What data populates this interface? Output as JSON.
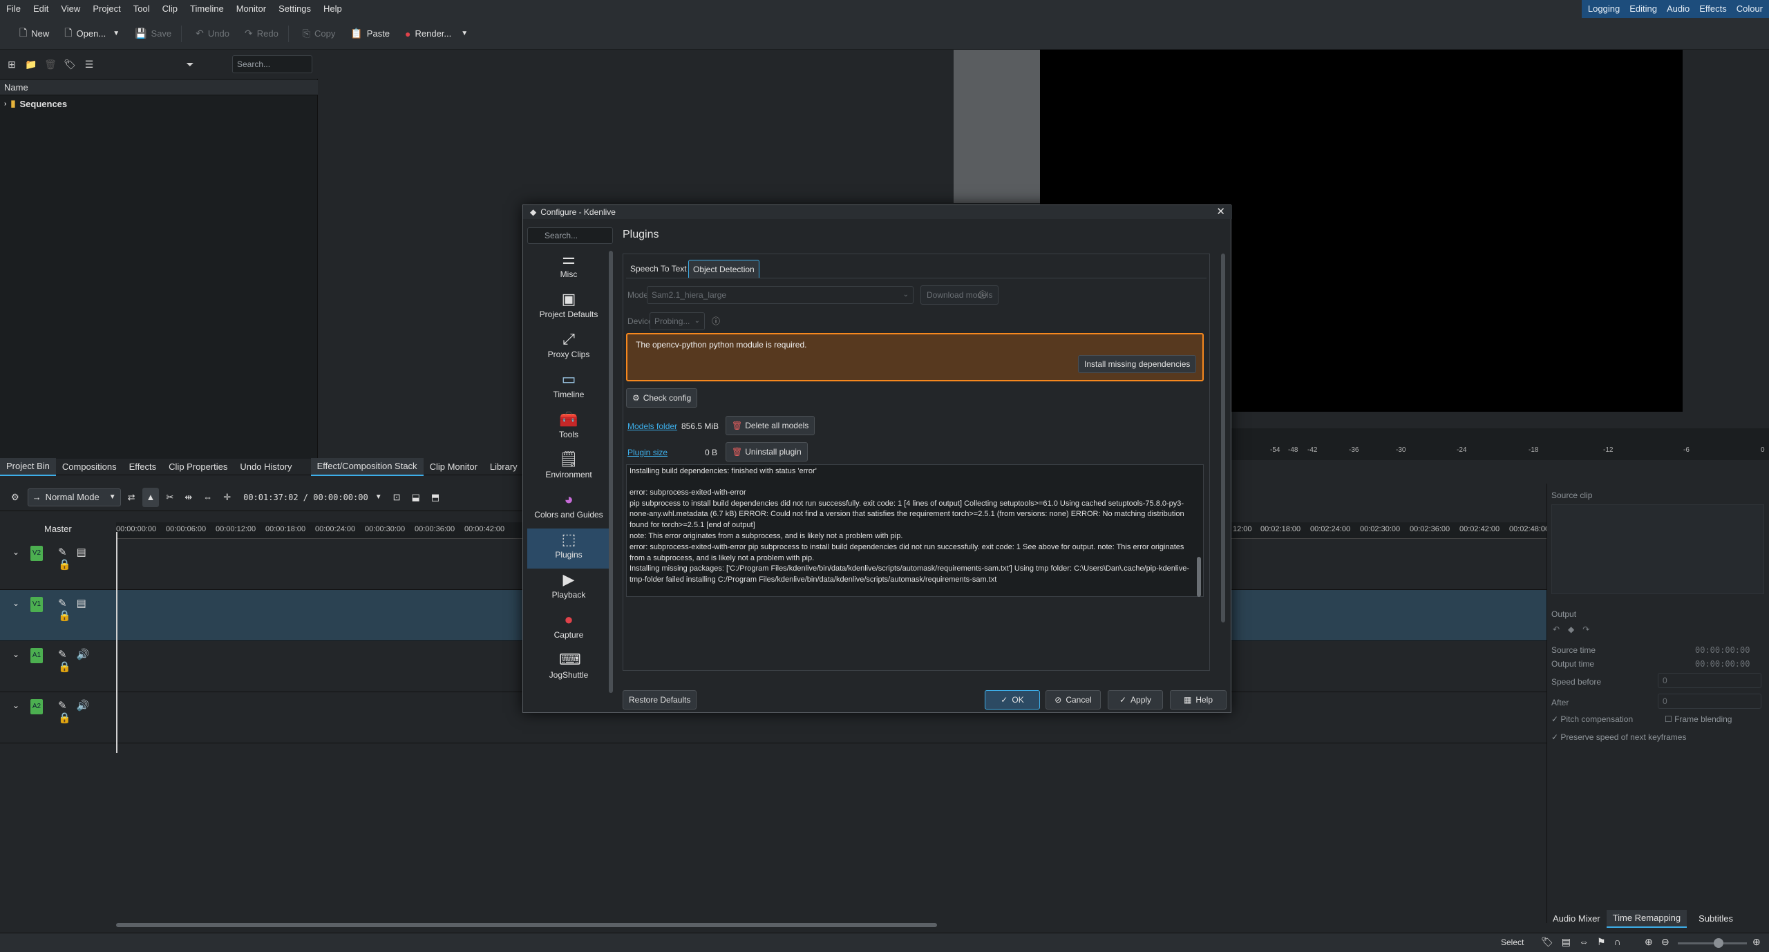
{
  "menubar": {
    "items": [
      "File",
      "Edit",
      "View",
      "Project",
      "Tool",
      "Clip",
      "Timeline",
      "Monitor",
      "Settings",
      "Help"
    ],
    "layouts": [
      "Logging",
      "Editing",
      "Audio",
      "Effects",
      "Colour"
    ]
  },
  "toolbar": {
    "new": "New",
    "open": "Open...",
    "save": "Save",
    "undo": "Undo",
    "redo": "Redo",
    "copy": "Copy",
    "paste": "Paste",
    "render": "Render..."
  },
  "bin": {
    "search_placeholder": "Search...",
    "column_name": "Name",
    "items": [
      "Sequences"
    ]
  },
  "bottom_tabs": [
    "Project Bin",
    "Compositions",
    "Effects",
    "Clip Properties",
    "Undo History",
    "Effect/Composition Stack",
    "Clip Monitor",
    "Library"
  ],
  "timeline": {
    "mode": "Normal Mode",
    "timecode": "00:01:37:02 / 00:00:00:00",
    "master": "Master",
    "ruler": [
      "00:00:00:00",
      "00:00:06:00",
      "00:00:12:00",
      "00:00:18:00",
      "00:00:24:00",
      "00:00:30:00",
      "00:00:36:00",
      "00:00:42:00"
    ],
    "ruler_right": [
      "12:00",
      "00:02:18:00",
      "00:02:24:00",
      "00:02:30:00",
      "00:02:36:00",
      "00:02:42:00",
      "00:02:48:00"
    ],
    "tracks": [
      "V2",
      "V1",
      "A1",
      "A2"
    ]
  },
  "meter_ticks": [
    "-54",
    "-48",
    "-42",
    "-36",
    "-30",
    "-24",
    "-18",
    "-12",
    "-6",
    "0"
  ],
  "right_panel": {
    "source_clip": "Source clip",
    "output": "Output",
    "source_time": "Source time",
    "output_time": "Output time",
    "source_time_val": "00:00:00:00",
    "output_time_val": "00:00:00:00",
    "speed_before": "Speed before",
    "after": "After",
    "speed_before_val": "0",
    "after_val": "0",
    "pitch": "Pitch compensation",
    "frame_blending": "Frame blending",
    "preserve": "Preserve speed of next keyframes",
    "tabs": [
      "Audio Mixer",
      "Time Remapping",
      "Subtitles"
    ]
  },
  "status": {
    "select": "Select"
  },
  "dialog": {
    "title": "Configure - Kdenlive",
    "search_placeholder": "Search...",
    "heading": "Plugins",
    "nav": [
      {
        "label": "Misc",
        "icon": "sliders-icon"
      },
      {
        "label": "Project Defaults",
        "icon": "project-icon"
      },
      {
        "label": "Proxy Clips",
        "icon": "proxy-icon"
      },
      {
        "label": "Timeline",
        "icon": "timeline-icon"
      },
      {
        "label": "Tools",
        "icon": "toolbox-icon"
      },
      {
        "label": "Environment",
        "icon": "terminal-icon"
      },
      {
        "label": "Colors and Guides",
        "icon": "color-wheel-icon"
      },
      {
        "label": "Plugins",
        "icon": "plugin-icon"
      },
      {
        "label": "Playback",
        "icon": "play-icon"
      },
      {
        "label": "Capture",
        "icon": "record-icon"
      },
      {
        "label": "JogShuttle",
        "icon": "jogshuttle-icon"
      }
    ],
    "tabs": [
      "Speech To Text",
      "Object Detection"
    ],
    "model_label": "Model",
    "model_value": "Sam2.1_hiera_large",
    "download_models": "Download models",
    "device_label": "Device",
    "device_value": "Probing...",
    "warning": "The opencv-python python module is required.",
    "install_deps": "Install missing dependencies",
    "check_config": "Check config",
    "models_folder": "Models folder",
    "models_size": "856.5 MiB",
    "delete_models": "Delete all models",
    "plugin_size": "Plugin size",
    "plugin_size_val": "0 B",
    "uninstall": "Uninstall plugin",
    "log": [
      "Installing build dependencies: finished with status 'error'",
      "",
      "error: subprocess-exited-with-error",
      "pip subprocess to install build dependencies did not run successfully. exit code: 1 [4 lines of output] Collecting setuptools>=61.0 Using cached setuptools-75.8.0-py3-none-any.whl.metadata (6.7 kB) ERROR: Could not find a version that satisfies the requirement torch>=2.5.1 (from versions: none) ERROR: No matching distribution found for torch>=2.5.1 [end of output]",
      "note: This error originates from a subprocess, and is likely not a problem with pip.",
      "error: subprocess-exited-with-error pip subprocess to install build dependencies did not run successfully. exit code: 1 See above for output. note: This error originates from a subprocess, and is likely not a problem with pip.",
      "Installing missing packages: ['C:/Program Files/kdenlive/bin/data/kdenlive/scripts/automask/requirements-sam.txt'] Using tmp folder: C:\\Users\\Dan\\.cache/pip-kdenlive-tmp-folder failed installing C:/Program Files/kdenlive/bin/data/kdenlive/scripts/automask/requirements-sam.txt"
    ],
    "restore_defaults": "Restore Defaults",
    "ok": "OK",
    "cancel": "Cancel",
    "apply": "Apply",
    "help": "Help"
  }
}
